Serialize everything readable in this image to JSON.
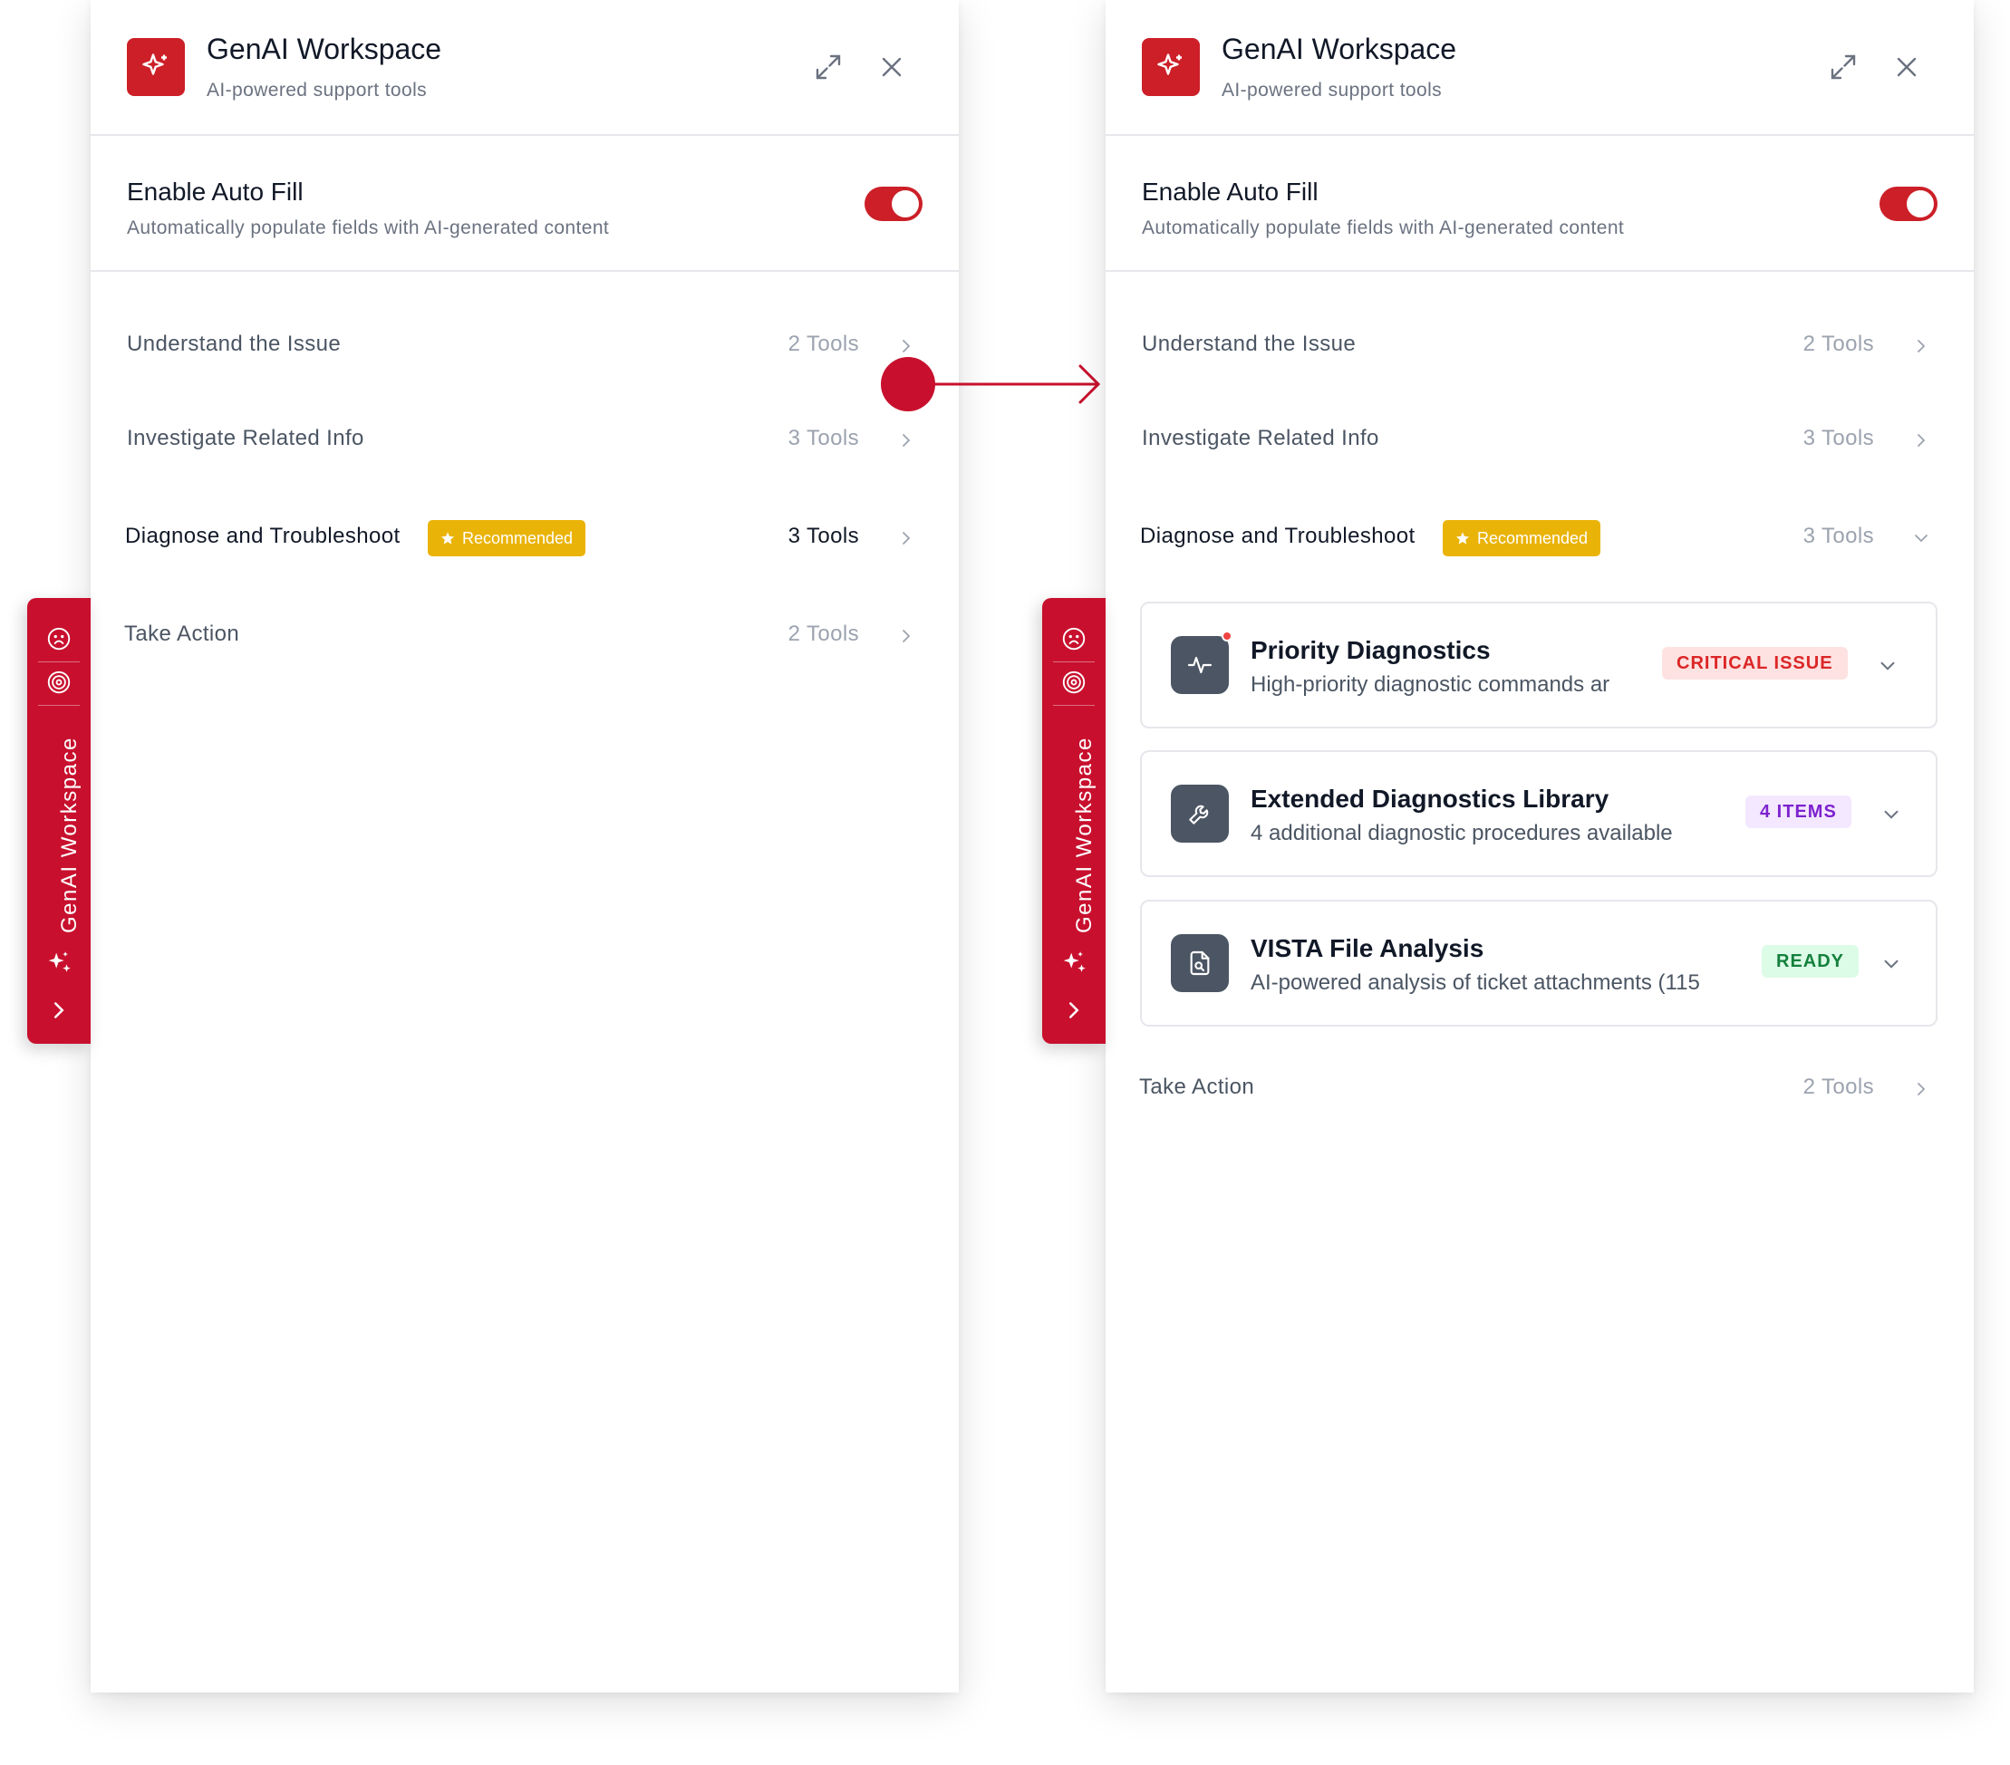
{
  "app": {
    "title": "GenAI Workspace",
    "subtitle": "AI-powered support tools"
  },
  "autofill": {
    "title": "Enable Auto Fill",
    "description": "Automatically populate fields with AI-generated content",
    "enabled": true
  },
  "sections": [
    {
      "label": "Understand the Issue",
      "count": "2 Tools"
    },
    {
      "label": "Investigate Related Info",
      "count": "3 Tools"
    },
    {
      "label": "Diagnose and Troubleshoot",
      "count": "3 Tools",
      "badge": "Recommended"
    },
    {
      "label": "Take Action",
      "count": "2 Tools"
    }
  ],
  "tools": [
    {
      "title": "Priority Diagnostics",
      "description": "High-priority diagnostic commands ar",
      "badge": "CRITICAL ISSUE",
      "icon": "activity-icon"
    },
    {
      "title": "Extended Diagnostics Library",
      "description": "4 additional diagnostic procedures available",
      "badge": "4 ITEMS",
      "icon": "wrench-icon"
    },
    {
      "title": "VISTA File Analysis",
      "description": "AI-powered analysis of ticket attachments (115",
      "badge": "READY",
      "icon": "file-search-icon"
    }
  ],
  "sidebar": {
    "label": "GenAI Workspace"
  },
  "colors": {
    "brand": "#cc1f27",
    "recommended": "#eab308",
    "critical_bg": "#fee2e2",
    "critical_text": "#dc2626",
    "items_bg": "#f3e8ff",
    "items_text": "#7e22ce",
    "ready_bg": "#dcfce7",
    "ready_text": "#15803d"
  }
}
